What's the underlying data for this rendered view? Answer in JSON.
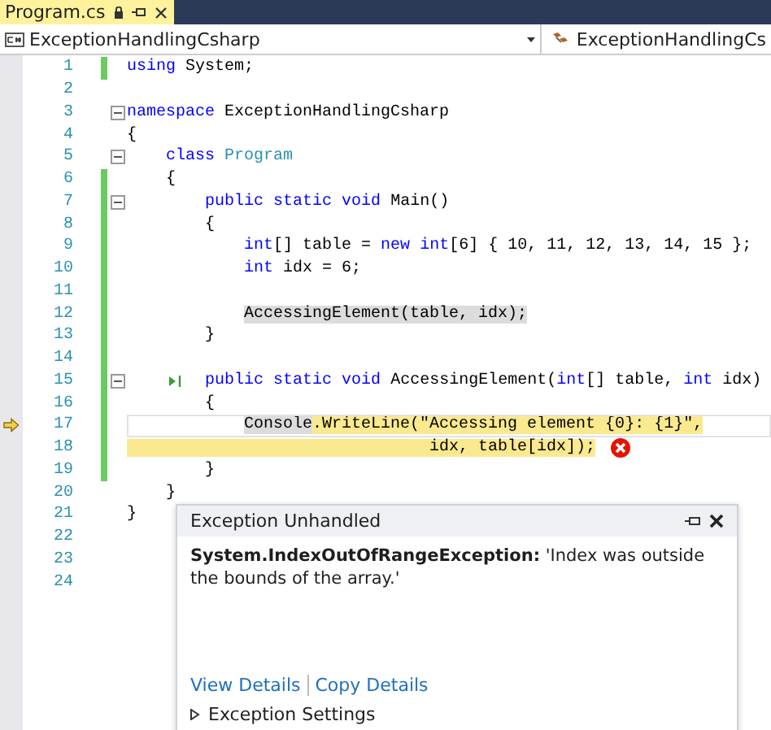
{
  "tab": {
    "label": "Program.cs",
    "selected": true
  },
  "nav": {
    "left": "ExceptionHandlingCsharp",
    "right": "ExceptionHandlingCs"
  },
  "lines": [
    {
      "number": "1",
      "changed": true,
      "foldable": false,
      "tokens": [
        {
          "kind": "kw",
          "text": "using"
        },
        {
          "kind": "text",
          "text": " System;"
        }
      ]
    },
    {
      "number": "2",
      "changed": false,
      "foldable": false
    },
    {
      "number": "3",
      "changed": false,
      "foldable": true,
      "tokens": [
        {
          "kind": "kw",
          "text": "namespace"
        },
        {
          "kind": "text",
          "text": " ExceptionHandlingCsharp"
        }
      ]
    },
    {
      "number": "4",
      "changed": false,
      "foldable": false,
      "tokens": [
        {
          "kind": "text",
          "text": "{"
        }
      ]
    },
    {
      "number": "5",
      "changed": false,
      "foldable": true,
      "tokens": [
        {
          "kind": "kw",
          "text": "    class"
        },
        {
          "kind": "type",
          "text": " Program"
        }
      ]
    },
    {
      "number": "6",
      "changed": true,
      "foldable": false,
      "tokens": [
        {
          "kind": "text",
          "text": "    {"
        }
      ]
    },
    {
      "number": "7",
      "changed": true,
      "foldable": true,
      "tokens": [
        {
          "kind": "kw",
          "text": "        public static void"
        },
        {
          "kind": "text",
          "text": " Main()"
        }
      ]
    },
    {
      "number": "8",
      "changed": true,
      "foldable": false,
      "tokens": [
        {
          "kind": "text",
          "text": "        {"
        }
      ]
    },
    {
      "number": "9",
      "changed": true,
      "foldable": false,
      "tokens": [
        {
          "kind": "kw",
          "text": "            int"
        },
        {
          "kind": "text",
          "text": "[] table = "
        },
        {
          "kind": "kw",
          "text": "new"
        },
        {
          "kind": "kw",
          "text": " int"
        },
        {
          "kind": "text",
          "text": "[6] { 10, 11, 12, 13, 14, 15 };"
        }
      ]
    },
    {
      "number": "10",
      "changed": true,
      "foldable": false,
      "tokens": [
        {
          "kind": "kw",
          "text": "            int"
        },
        {
          "kind": "text",
          "text": " idx = 6;"
        }
      ]
    },
    {
      "number": "11",
      "changed": true,
      "foldable": false
    },
    {
      "number": "12",
      "changed": true,
      "foldable": false,
      "tokens": [
        {
          "kind": "call",
          "text": "            AccessingElement(table, idx);"
        }
      ]
    },
    {
      "number": "13",
      "changed": true,
      "foldable": false,
      "tokens": [
        {
          "kind": "text",
          "text": "        }"
        }
      ]
    },
    {
      "number": "14",
      "changed": true,
      "foldable": false
    },
    {
      "number": "15",
      "changed": true,
      "foldable": true,
      "tokens": [
        {
          "kind": "run"
        },
        {
          "kind": "kw",
          "text": "  public static void"
        },
        {
          "kind": "text",
          "text": " AccessingElement("
        },
        {
          "kind": "kw",
          "text": "int"
        },
        {
          "kind": "text",
          "text": "[] table, "
        },
        {
          "kind": "kw",
          "text": "int"
        },
        {
          "kind": "text",
          "text": " idx)"
        }
      ]
    },
    {
      "number": "16",
      "changed": true,
      "foldable": false,
      "tokens": [
        {
          "kind": "text",
          "text": "        {"
        }
      ]
    },
    {
      "number": "17",
      "changed": true,
      "foldable": false,
      "current": true,
      "tokens": [
        {
          "kind": "call",
          "text": "            Console"
        },
        {
          "kind": "current",
          "text": ".WriteLine(\"Accessing element {0}: {1}\","
        }
      ]
    },
    {
      "number": "18",
      "changed": true,
      "foldable": false,
      "tokens": [
        {
          "kind": "current",
          "text": "                               idx, table[idx]);"
        },
        {
          "kind": "error"
        }
      ]
    },
    {
      "number": "19",
      "changed": true,
      "foldable": false,
      "tokens": [
        {
          "kind": "text",
          "text": "        }"
        }
      ]
    },
    {
      "number": "20",
      "changed": false,
      "foldable": false,
      "tokens": [
        {
          "kind": "text",
          "text": "    }"
        }
      ]
    },
    {
      "number": "21",
      "changed": false,
      "foldable": false,
      "tokens": [
        {
          "kind": "text",
          "text": "}"
        }
      ]
    },
    {
      "number": "22",
      "changed": false,
      "foldable": false
    },
    {
      "number": "23",
      "changed": false,
      "foldable": false
    },
    {
      "number": "24",
      "changed": false,
      "foldable": false
    }
  ],
  "popup": {
    "title": "Exception Unhandled",
    "message": "**System.IndexOutOfRangeException:** 'Index was outside the bounds of the array.'",
    "links": [
      "View Details",
      "Copy Details"
    ],
    "settings": {
      "label": "Exception Settings",
      "expanded": false
    }
  }
}
